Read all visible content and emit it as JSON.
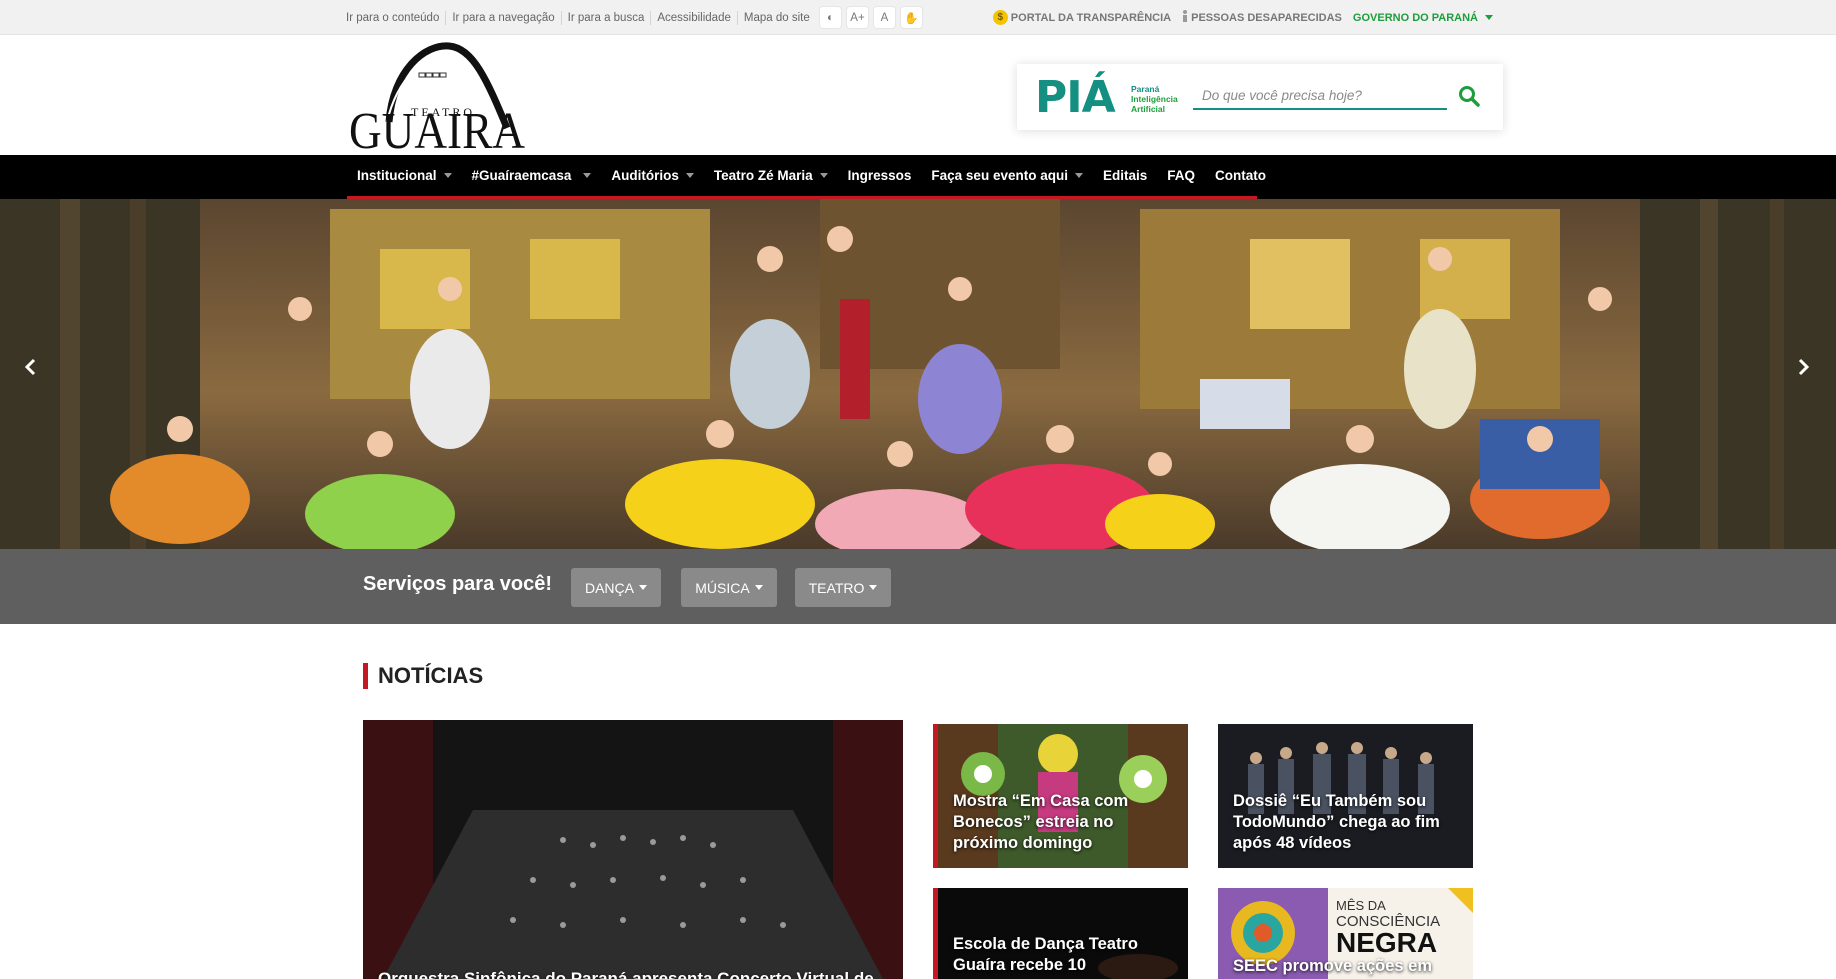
{
  "skiplinks": [
    "Ir para o conteúdo",
    "Ir para a navegação",
    "Ir para a busca",
    "Acessibilidade",
    "Mapa do site"
  ],
  "accessibility": {
    "contrast": "◐",
    "increase": "A+",
    "reset": "A",
    "libras": "✋"
  },
  "gov": {
    "transparencia": "PORTAL DA TRANSPARÊNCIA",
    "desaparecidas": "PESSOAS DESAPARECIDAS",
    "governo": "GOVERNO DO PARANÁ"
  },
  "logo": {
    "top": "TEATRO",
    "main": "GUAIRA"
  },
  "pia": {
    "name": "PIÁ",
    "line1": "Paraná",
    "line2": "Inteligência",
    "line3": "Artificial"
  },
  "search": {
    "placeholder": "Do que você precisa hoje?"
  },
  "nav": [
    {
      "label": "Institucional",
      "dropdown": true
    },
    {
      "label": "#Guaíraemcasa",
      "dropdown": true
    },
    {
      "label": "Auditórios",
      "dropdown": true
    },
    {
      "label": "Teatro Zé Maria",
      "dropdown": true
    },
    {
      "label": "Ingressos",
      "dropdown": false
    },
    {
      "label": "Faça seu evento aqui",
      "dropdown": true
    },
    {
      "label": "Editais",
      "dropdown": false
    },
    {
      "label": "FAQ",
      "dropdown": false
    },
    {
      "label": "Contato",
      "dropdown": false
    }
  ],
  "services": {
    "title": "Serviços para você!",
    "buttons": [
      "DANÇA",
      "MÚSICA",
      "TEATRO"
    ]
  },
  "news": {
    "title": "NOTÍCIAS",
    "cards": [
      "Orquestra Sinfônica do Paraná apresenta Concerto Virtual de",
      "Mostra “Em Casa com Bonecos” estreia no próximo domingo",
      "Dossiê “Eu Também sou TodoMundo” chega ao fim após 48 vídeos",
      "Escola de Dança Teatro Guaíra recebe 10",
      "SEEC promove ações em"
    ],
    "promo": {
      "line1": "MÊS DA",
      "line2": "CONSCIÊNCIA",
      "line3": "NEGRA"
    }
  },
  "colors": {
    "accent_red": "#c41923",
    "pia_teal": "#148f82",
    "gov_green": "#1e9d3c",
    "nav_bg": "#000000",
    "services_bg": "#5f5f5f"
  }
}
